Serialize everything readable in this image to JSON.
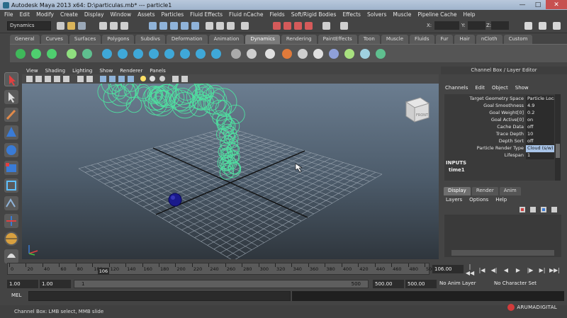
{
  "window": {
    "title": "Autodesk Maya 2013 x64: D:\\particulas.mb*  ---  particle1",
    "minimize": "—",
    "maximize": "□",
    "close": "✕"
  },
  "menubar": [
    "File",
    "Edit",
    "Modify",
    "Create",
    "Display",
    "Window",
    "Assets",
    "Particles",
    "Fluid Effects",
    "Fluid nCache",
    "Fields",
    "Soft/Rigid Bodies",
    "Effects",
    "Solvers",
    "Muscle",
    "Pipeline Cache",
    "Help"
  ],
  "statusline": {
    "mode": "Dynamics",
    "x_label": "X:",
    "y_label": "Y:",
    "z_label": "Z:"
  },
  "shelf_tabs": [
    "General",
    "Curves",
    "Surfaces",
    "Polygons",
    "Subdivs",
    "Deformation",
    "Animation",
    "Dynamics",
    "Rendering",
    "PaintEffects",
    "Toon",
    "Muscle",
    "Fluids",
    "Fur",
    "Hair",
    "nCloth",
    "Custom"
  ],
  "shelf_active": "Dynamics",
  "viewport": {
    "menu": [
      "View",
      "Shading",
      "Lighting",
      "Show",
      "Renderer",
      "Panels"
    ],
    "viewcube_label": "FRONT"
  },
  "channel_box": {
    "header": "Channel Box / Layer Editor",
    "menu": [
      "Channels",
      "Edit",
      "Object",
      "Show"
    ],
    "attributes": [
      {
        "name": "Target Geometry Space",
        "value": "Particle Local"
      },
      {
        "name": "Goal Smoothness",
        "value": "4.9"
      },
      {
        "name": "Goal Weight[0]",
        "value": "0.2"
      },
      {
        "name": "Goal Active[0]",
        "value": "on"
      },
      {
        "name": "Cache Data",
        "value": "off"
      },
      {
        "name": "Trace Depth",
        "value": "10"
      },
      {
        "name": "Depth Sort",
        "value": "off"
      },
      {
        "name": "Particle Render Type",
        "value": "Cloud (s/w)"
      },
      {
        "name": "Lifespan",
        "value": "1"
      }
    ],
    "inputs_label": "INPUTS",
    "input_node": "time1"
  },
  "layer_editor": {
    "tabs": [
      "Display",
      "Render",
      "Anim"
    ],
    "active_tab": "Display",
    "menu": [
      "Layers",
      "Options",
      "Help"
    ]
  },
  "timeslider": {
    "ticks": [
      "0",
      "20",
      "40",
      "60",
      "80",
      "100",
      "120",
      "140",
      "160",
      "180",
      "200",
      "220",
      "240",
      "260",
      "280",
      "300",
      "320",
      "340",
      "360",
      "380",
      "400",
      "420",
      "440",
      "460",
      "480",
      "500"
    ],
    "current_frame": "106",
    "end_field": "106.00",
    "controls": [
      "|◀◀",
      "|◀",
      "◀|",
      "◀",
      "▶",
      "|▶",
      "▶|",
      "▶▶|"
    ]
  },
  "range": {
    "start_time": "1.00",
    "start_playback": "1.00",
    "range_start": "1",
    "range_end": "500",
    "end_playback": "500.00",
    "end_time": "500.00",
    "anim_layer": "No Anim Layer",
    "character_set": "No Character Set"
  },
  "command_line": {
    "label": "MEL",
    "value": ""
  },
  "help_line": "Channel Box: LMB select, MMB slide",
  "watermark": "ARUMADIGITAL",
  "colors": {
    "particles": "#4fe0a0",
    "sphere": "#1a1a8c",
    "accent_red": "#d23b3b"
  }
}
